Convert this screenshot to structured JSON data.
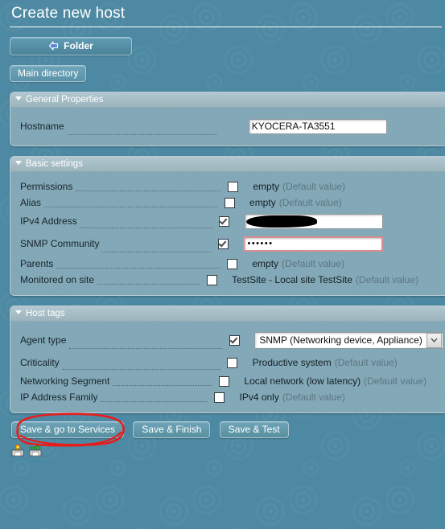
{
  "page": {
    "title": "Create new host"
  },
  "topbar": {
    "folder_button": "Folder",
    "folder_icon": "arrow-left-icon",
    "main_directory_button": "Main directory"
  },
  "sections": {
    "general": {
      "header": "General Properties",
      "rows": [
        {
          "label": "Hostname",
          "value": "KYOCERA-TA3551"
        }
      ]
    },
    "basic": {
      "header": "Basic settings",
      "rows": [
        {
          "label": "Permissions",
          "checked": false,
          "value": "empty",
          "default_note": "(Default value)"
        },
        {
          "label": "Alias",
          "checked": false,
          "value": "empty",
          "default_note": "(Default value)"
        },
        {
          "label": "IPv4 Address",
          "checked": true,
          "value": "",
          "default_note": ""
        },
        {
          "label": "SNMP Community",
          "checked": true,
          "value": "••••••",
          "default_note": ""
        },
        {
          "label": "Parents",
          "checked": false,
          "value": "empty",
          "default_note": "(Default value)"
        },
        {
          "label": "Monitored on site",
          "checked": false,
          "value": "TestSite - Local site TestSite",
          "default_note": "(Default value)"
        }
      ]
    },
    "hosttags": {
      "header": "Host tags",
      "rows": [
        {
          "label": "Agent type",
          "checked": true,
          "value": "SNMP (Networking device, Appliance)",
          "default_note": ""
        },
        {
          "label": "Criticality",
          "checked": false,
          "value": "Productive system",
          "default_note": "(Default value)"
        },
        {
          "label": "Networking Segment",
          "checked": false,
          "value": "Local network (low latency)",
          "default_note": "(Default value)"
        },
        {
          "label": "IP Address Family",
          "checked": false,
          "value": "IPv4 only",
          "default_note": "(Default value)"
        }
      ]
    }
  },
  "footer": {
    "save_services_button": "Save & go to Services",
    "save_finish_button": "Save & Finish",
    "save_test_button": "Save & Test",
    "icons": [
      "save-to-disk-settings-icon",
      "save-to-disk-export-icon"
    ]
  },
  "annotation": {
    "shape": "hand-drawn-red-ellipse",
    "color": "#e81c1c",
    "target": "Save & go to Services"
  },
  "colors": {
    "page_background": "#4d89a2",
    "panel_body": "#82a8b7",
    "panel_header": "#a8c0c9",
    "button_blue": "#6fa4b9",
    "error_border": "#d88f8f",
    "annotation_red": "#e81c1c"
  }
}
